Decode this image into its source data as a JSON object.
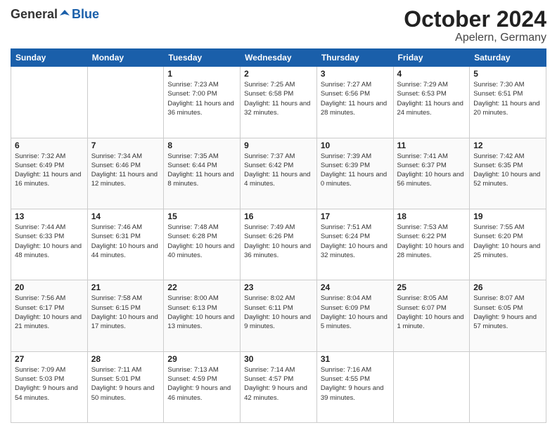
{
  "header": {
    "logo_general": "General",
    "logo_blue": "Blue",
    "title": "October 2024",
    "subtitle": "Apelern, Germany"
  },
  "days_of_week": [
    "Sunday",
    "Monday",
    "Tuesday",
    "Wednesday",
    "Thursday",
    "Friday",
    "Saturday"
  ],
  "weeks": [
    [
      {
        "day": "",
        "info": ""
      },
      {
        "day": "",
        "info": ""
      },
      {
        "day": "1",
        "info": "Sunrise: 7:23 AM\nSunset: 7:00 PM\nDaylight: 11 hours and 36 minutes."
      },
      {
        "day": "2",
        "info": "Sunrise: 7:25 AM\nSunset: 6:58 PM\nDaylight: 11 hours and 32 minutes."
      },
      {
        "day": "3",
        "info": "Sunrise: 7:27 AM\nSunset: 6:56 PM\nDaylight: 11 hours and 28 minutes."
      },
      {
        "day": "4",
        "info": "Sunrise: 7:29 AM\nSunset: 6:53 PM\nDaylight: 11 hours and 24 minutes."
      },
      {
        "day": "5",
        "info": "Sunrise: 7:30 AM\nSunset: 6:51 PM\nDaylight: 11 hours and 20 minutes."
      }
    ],
    [
      {
        "day": "6",
        "info": "Sunrise: 7:32 AM\nSunset: 6:49 PM\nDaylight: 11 hours and 16 minutes."
      },
      {
        "day": "7",
        "info": "Sunrise: 7:34 AM\nSunset: 6:46 PM\nDaylight: 11 hours and 12 minutes."
      },
      {
        "day": "8",
        "info": "Sunrise: 7:35 AM\nSunset: 6:44 PM\nDaylight: 11 hours and 8 minutes."
      },
      {
        "day": "9",
        "info": "Sunrise: 7:37 AM\nSunset: 6:42 PM\nDaylight: 11 hours and 4 minutes."
      },
      {
        "day": "10",
        "info": "Sunrise: 7:39 AM\nSunset: 6:39 PM\nDaylight: 11 hours and 0 minutes."
      },
      {
        "day": "11",
        "info": "Sunrise: 7:41 AM\nSunset: 6:37 PM\nDaylight: 10 hours and 56 minutes."
      },
      {
        "day": "12",
        "info": "Sunrise: 7:42 AM\nSunset: 6:35 PM\nDaylight: 10 hours and 52 minutes."
      }
    ],
    [
      {
        "day": "13",
        "info": "Sunrise: 7:44 AM\nSunset: 6:33 PM\nDaylight: 10 hours and 48 minutes."
      },
      {
        "day": "14",
        "info": "Sunrise: 7:46 AM\nSunset: 6:31 PM\nDaylight: 10 hours and 44 minutes."
      },
      {
        "day": "15",
        "info": "Sunrise: 7:48 AM\nSunset: 6:28 PM\nDaylight: 10 hours and 40 minutes."
      },
      {
        "day": "16",
        "info": "Sunrise: 7:49 AM\nSunset: 6:26 PM\nDaylight: 10 hours and 36 minutes."
      },
      {
        "day": "17",
        "info": "Sunrise: 7:51 AM\nSunset: 6:24 PM\nDaylight: 10 hours and 32 minutes."
      },
      {
        "day": "18",
        "info": "Sunrise: 7:53 AM\nSunset: 6:22 PM\nDaylight: 10 hours and 28 minutes."
      },
      {
        "day": "19",
        "info": "Sunrise: 7:55 AM\nSunset: 6:20 PM\nDaylight: 10 hours and 25 minutes."
      }
    ],
    [
      {
        "day": "20",
        "info": "Sunrise: 7:56 AM\nSunset: 6:17 PM\nDaylight: 10 hours and 21 minutes."
      },
      {
        "day": "21",
        "info": "Sunrise: 7:58 AM\nSunset: 6:15 PM\nDaylight: 10 hours and 17 minutes."
      },
      {
        "day": "22",
        "info": "Sunrise: 8:00 AM\nSunset: 6:13 PM\nDaylight: 10 hours and 13 minutes."
      },
      {
        "day": "23",
        "info": "Sunrise: 8:02 AM\nSunset: 6:11 PM\nDaylight: 10 hours and 9 minutes."
      },
      {
        "day": "24",
        "info": "Sunrise: 8:04 AM\nSunset: 6:09 PM\nDaylight: 10 hours and 5 minutes."
      },
      {
        "day": "25",
        "info": "Sunrise: 8:05 AM\nSunset: 6:07 PM\nDaylight: 10 hours and 1 minute."
      },
      {
        "day": "26",
        "info": "Sunrise: 8:07 AM\nSunset: 6:05 PM\nDaylight: 9 hours and 57 minutes."
      }
    ],
    [
      {
        "day": "27",
        "info": "Sunrise: 7:09 AM\nSunset: 5:03 PM\nDaylight: 9 hours and 54 minutes."
      },
      {
        "day": "28",
        "info": "Sunrise: 7:11 AM\nSunset: 5:01 PM\nDaylight: 9 hours and 50 minutes."
      },
      {
        "day": "29",
        "info": "Sunrise: 7:13 AM\nSunset: 4:59 PM\nDaylight: 9 hours and 46 minutes."
      },
      {
        "day": "30",
        "info": "Sunrise: 7:14 AM\nSunset: 4:57 PM\nDaylight: 9 hours and 42 minutes."
      },
      {
        "day": "31",
        "info": "Sunrise: 7:16 AM\nSunset: 4:55 PM\nDaylight: 9 hours and 39 minutes."
      },
      {
        "day": "",
        "info": ""
      },
      {
        "day": "",
        "info": ""
      }
    ]
  ]
}
